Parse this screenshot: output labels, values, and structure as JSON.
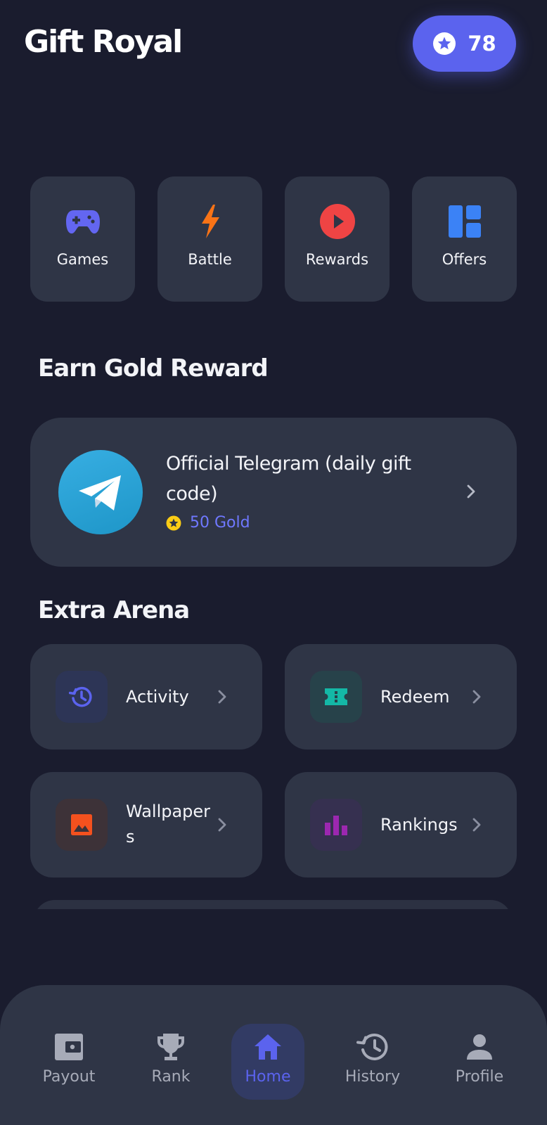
{
  "app": {
    "title": "Gift Royal",
    "coins": "78"
  },
  "quick_actions": [
    {
      "label": "Games",
      "icon": "gamepad-icon",
      "color": "#6366f1"
    },
    {
      "label": "Battle",
      "icon": "lightning-icon",
      "color": "#f97316"
    },
    {
      "label": "Rewards",
      "icon": "play-icon",
      "color": "#ef4444"
    },
    {
      "label": "Offers",
      "icon": "dashboard-icon",
      "color": "#3b82f6"
    }
  ],
  "earn": {
    "section_title": "Earn Gold Reward",
    "card": {
      "title": "Official Telegram (daily gift code)",
      "reward": "50 Gold",
      "icon": "telegram-icon"
    }
  },
  "arena": {
    "section_title": "Extra Arena",
    "items": [
      {
        "label": "Activity",
        "icon": "history-icon",
        "color": "#5b63ee",
        "bg": "#2d3556"
      },
      {
        "label": "Redeem",
        "icon": "ticket-icon",
        "color": "#14b8a6",
        "bg": "#27424a"
      },
      {
        "label": "Wallpaper s",
        "icon": "image-icon",
        "color": "#f4511e",
        "bg": "#3d3238"
      },
      {
        "label": "Rankings",
        "icon": "bar-chart-icon",
        "color": "#9c27b0",
        "bg": "#363050"
      }
    ]
  },
  "nav": {
    "items": [
      {
        "label": "Payout",
        "icon": "wallet-icon",
        "active": false
      },
      {
        "label": "Rank",
        "icon": "trophy-icon",
        "active": false
      },
      {
        "label": "Home",
        "icon": "home-icon",
        "active": true
      },
      {
        "label": "History",
        "icon": "history-icon",
        "active": false
      },
      {
        "label": "Profile",
        "icon": "person-icon",
        "active": false
      }
    ],
    "active_color": "#5b63ee",
    "inactive_color": "#a7abb8"
  }
}
